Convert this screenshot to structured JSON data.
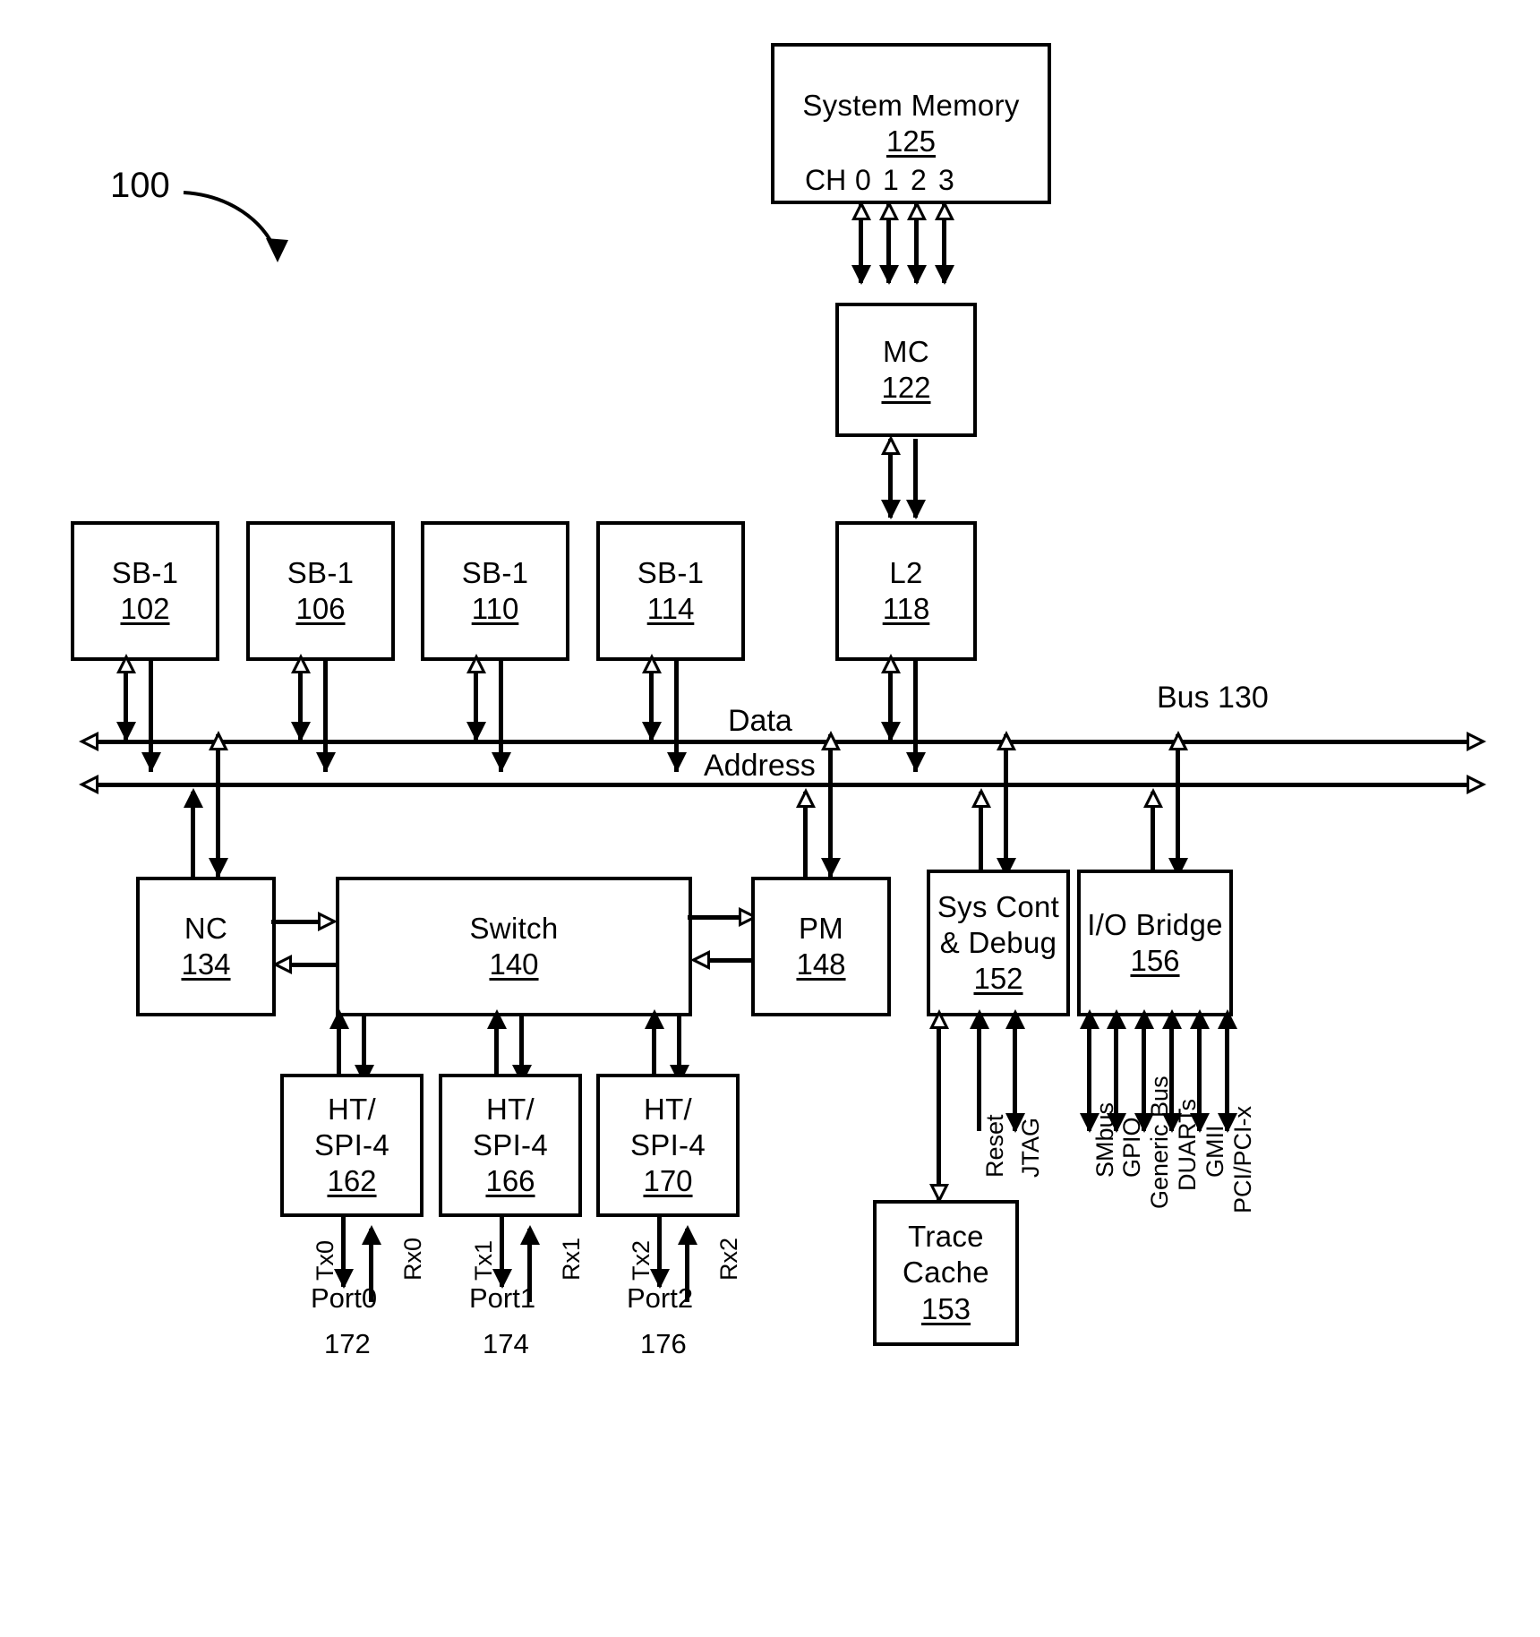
{
  "figure": {
    "number": "100"
  },
  "blocks": {
    "system_memory": {
      "title": "System Memory",
      "number": "125",
      "channels_label": "CH",
      "channels": [
        "0",
        "1",
        "2",
        "3"
      ]
    },
    "mc": {
      "title": "MC",
      "number": "122"
    },
    "l2": {
      "title": "L2",
      "number": "118"
    },
    "sb1_a": {
      "title": "SB-1",
      "number": "102"
    },
    "sb1_b": {
      "title": "SB-1",
      "number": "106"
    },
    "sb1_c": {
      "title": "SB-1",
      "number": "110"
    },
    "sb1_d": {
      "title": "SB-1",
      "number": "114"
    },
    "nc": {
      "title": "NC",
      "number": "134"
    },
    "switch": {
      "title": "Switch",
      "number": "140"
    },
    "pm": {
      "title": "PM",
      "number": "148"
    },
    "syscont": {
      "title_line1": "Sys Cont",
      "title_line2": "& Debug",
      "number": "152"
    },
    "iobridge": {
      "title": "I/O Bridge",
      "number": "156"
    },
    "trace": {
      "title_line1": "Trace",
      "title_line2": "Cache",
      "number": "153"
    },
    "ht0": {
      "title_line1": "HT/",
      "title_line2": "SPI-4",
      "number": "162"
    },
    "ht1": {
      "title_line1": "HT/",
      "title_line2": "SPI-4",
      "number": "166"
    },
    "ht2": {
      "title_line1": "HT/",
      "title_line2": "SPI-4",
      "number": "170"
    }
  },
  "bus": {
    "name": "Bus 130",
    "data_label": "Data",
    "address_label": "Address"
  },
  "ports": [
    {
      "tx": "Tx0",
      "rx": "Rx0",
      "name": "Port0",
      "number": "172"
    },
    {
      "tx": "Tx1",
      "rx": "Rx1",
      "name": "Port1",
      "number": "174"
    },
    {
      "tx": "Tx2",
      "rx": "Rx2",
      "name": "Port2",
      "number": "176"
    }
  ],
  "syscont_signals": [
    "Reset",
    "JTAG"
  ],
  "iobridge_signals": [
    "SMbus",
    "GPIO",
    "Generic Bus",
    "DUARTs",
    "GMII",
    "PCI/PCI-x"
  ],
  "colors": {
    "line": "#000000",
    "background": "#ffffff"
  }
}
